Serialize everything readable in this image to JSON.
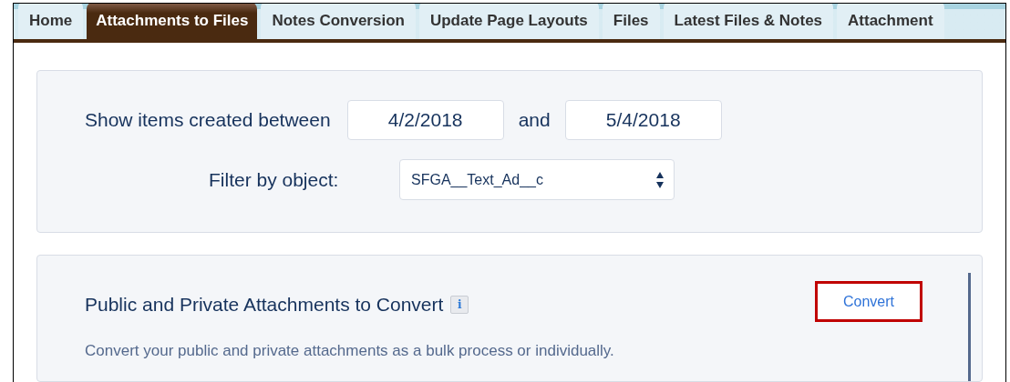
{
  "tabs": [
    {
      "label": "Home",
      "selected": false
    },
    {
      "label": "Attachments to Files",
      "selected": true
    },
    {
      "label": "Notes Conversion",
      "selected": false
    },
    {
      "label": "Update Page Layouts",
      "selected": false
    },
    {
      "label": "Files",
      "selected": false
    },
    {
      "label": "Latest Files & Notes",
      "selected": false
    },
    {
      "label": "Attachment",
      "selected": false
    }
  ],
  "filter": {
    "label": "Show items created between",
    "start": "4/2/2018",
    "joiner": "and",
    "end": "5/4/2018",
    "object_label": "Filter by object:",
    "object_value": "SFGA__Text_Ad__c"
  },
  "section": {
    "title": "Public and Private Attachments to Convert",
    "info": "i",
    "button": "Convert",
    "description": "Convert your public and private attachments as a bulk process or individually."
  }
}
